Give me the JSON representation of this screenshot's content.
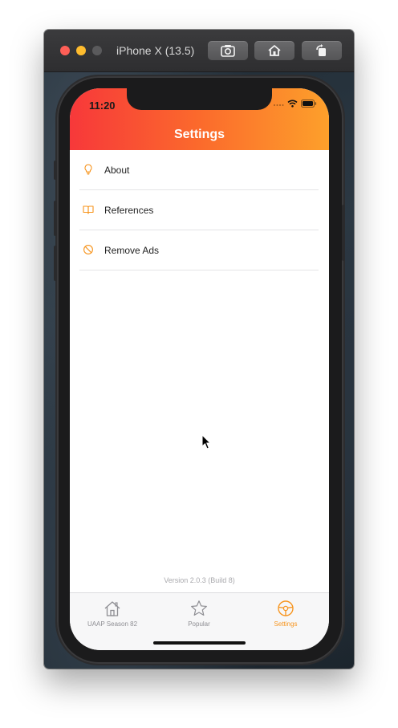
{
  "simulator": {
    "title": "iPhone X (13.5)",
    "toolbar_icons": [
      "screenshot-icon",
      "home-icon",
      "rotate-icon"
    ]
  },
  "status_bar": {
    "time": "11:20"
  },
  "header": {
    "title": "Settings"
  },
  "menu": {
    "items": [
      {
        "label": "About",
        "icon": "lightbulb-icon"
      },
      {
        "label": "References",
        "icon": "book-icon"
      },
      {
        "label": "Remove Ads",
        "icon": "prohibited-icon"
      }
    ]
  },
  "footer": {
    "version": "Version 2.0.3 (Build 8)"
  },
  "tabbar": {
    "tabs": [
      {
        "label": "UAAP Season 82",
        "icon": "house-icon",
        "active": false
      },
      {
        "label": "Popular",
        "icon": "star-icon",
        "active": false
      },
      {
        "label": "Settings",
        "icon": "steering-wheel-icon",
        "active": true
      }
    ]
  },
  "colors": {
    "accent": "#f7941d",
    "header_gradient_start": "#f7383a",
    "header_gradient_end": "#fda02b"
  }
}
